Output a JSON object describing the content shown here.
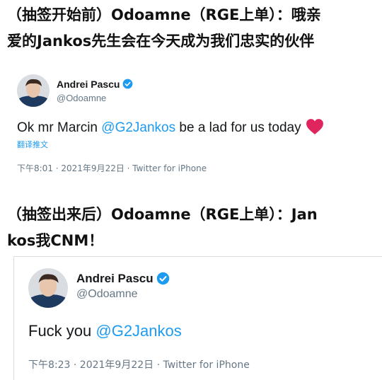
{
  "captions": {
    "first_line1": "（抽签开始前）Odoamne（RGE上单）：哦亲",
    "first_line2": "爱的Jankos先生会在今天成为我们忠实的伙伴",
    "second_line1": "（抽签出来后）Odoamne（RGE上单）：Jan",
    "second_line2": "kos我CNM！"
  },
  "tweet1": {
    "name": "Andrei Pascu",
    "handle": "@Odoamne",
    "text_before": "Ok mr Marcin ",
    "mention": "@G2Jankos",
    "text_after": " be a lad for us today",
    "translate_label": "翻译推文",
    "meta": "下午8:01 · 2021年9月22日 · Twitter for iPhone"
  },
  "tweet2": {
    "name": "Andrei Pascu",
    "handle": "@Odoamne",
    "text_before": "Fuck you ",
    "mention": "@G2Jankos",
    "meta": "下午8:23 · 2021年9月22日 · Twitter for iPhone"
  },
  "colors": {
    "link": "#1d9bf0",
    "verified": "#1d9bf0",
    "heart": "#e0245e",
    "secondary_text": "#657786"
  },
  "icons": [
    "avatar",
    "verified-badge-icon",
    "heart-icon"
  ]
}
